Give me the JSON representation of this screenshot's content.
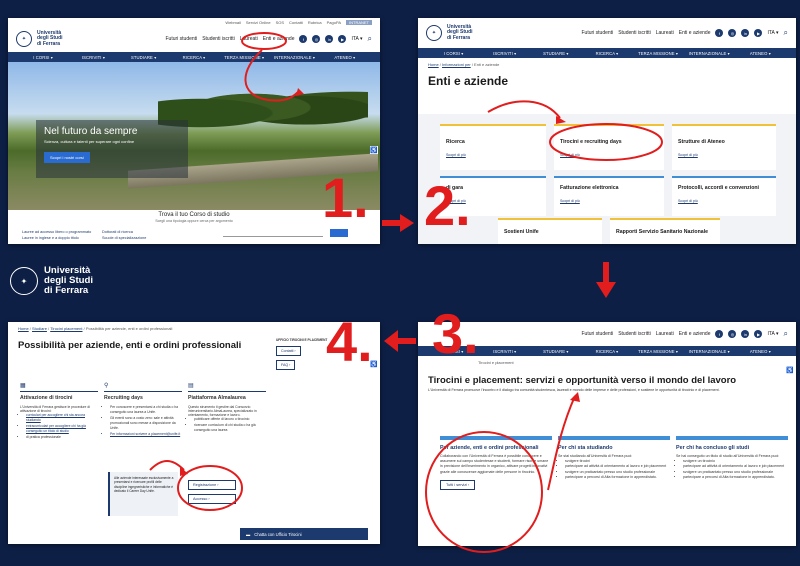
{
  "colors": {
    "brand": "#1d3a6e",
    "annotation": "#e11d1d",
    "accent_blue": "#3f8ed6",
    "accent_yellow": "#f0c23a",
    "background": "#0d1f44"
  },
  "steps": [
    "1.",
    "2.",
    "3.",
    "4."
  ],
  "logo": {
    "line1": "Università",
    "line2": "degli Studi",
    "line3": "di Ferrara"
  },
  "utility_links": [
    "Webmail",
    "Servizi Online",
    "SOS",
    "Contatti",
    "Rubrica",
    "PagoPA",
    "INTRANET"
  ],
  "header": {
    "links": [
      "Futuri studenti",
      "Studenti iscritti",
      "Laureati",
      "Enti e aziende"
    ],
    "lang": "ITA ▾",
    "social": [
      "f",
      "◎",
      "in",
      "▶"
    ]
  },
  "nav": [
    "I CORSI ▾",
    "ISCRIVITI ▾",
    "STUDIARE ▾",
    "RICERCA ▾",
    "TERZA MISSIONE ▾",
    "INTERNAZIONALE ▾",
    "ATENEO ▾"
  ],
  "panel1": {
    "hero_title": "Nel futuro da sempre",
    "hero_subtitle": "Scienza, cultura e talenti per superare ogni confine",
    "hero_button": "Scopri i nostri corsi",
    "corsi_title": "Trova il tuo Corso di studio",
    "corsi_subtitle": "Scegli una tipologia oppure cerca per argomento",
    "corsi_links": [
      "Lauree ad accesso libero o programmato",
      "Dottorati di ricerca",
      "Lauree in inglese e a doppio titolo",
      "Scuole di specializzazione"
    ]
  },
  "panel2": {
    "breadcrumb": [
      "Home",
      "Informazioni per",
      "Enti e aziende"
    ],
    "title": "Enti e aziende",
    "more": "Scopri di più",
    "cards": [
      "Ricerca",
      "Tirocini e recruiting days",
      "Strutture di Ateneo",
      "di gara",
      "Fatturazione elettronica",
      "Protocolli, accordi e convenzioni",
      "Sostieni Unife",
      "Rapporti Servizio Sanitario Nazionale"
    ]
  },
  "panel3": {
    "breadcrumb": "Tirocini e placement",
    "title": "Tirocini e placement: servizi e opportunità verso il mondo del lavoro",
    "intro": "L'Università di Ferrara promuove l'incontro e il dialogo tra comunità studentesca, laureati e mondo delle imprese e delle professioni, e sostiene le opportunità di tirocinio e di placement.",
    "columns": [
      {
        "title": "Per aziende, enti e ordini professionali",
        "text": "Collaborando con l'Università di Ferrara è possibile conoscere e assumere sul campo studentesse e studenti, formare risorse umane in previsione dell'inserimento in organico, attivare progetti innovativi grazie alle conoscenze aggiornate delle persone in tirocinio.",
        "button": "Tutti i servizi  ›"
      },
      {
        "title": "Per chi sta studiando",
        "text": "Se stai studiando all'Università di Ferrara puoi:",
        "items": [
          "svolgere tirocini",
          "partecipare ad attività di orientamento al lavoro e job placement",
          "svolgere un praticantato presso uno studio professionale",
          "partecipare a percorsi di Alta formazione in apprendistato."
        ]
      },
      {
        "title": "Per chi ha concluso gli studi",
        "text": "Se hai conseguito un titolo di studio all'Università di Ferrara puoi:",
        "items": [
          "svolgere un tirocinio",
          "partecipare ad attività di orientamento al lavoro e job placement",
          "svolgere un praticantato presso uno studio professionale",
          "partecipare a percorsi di Alta formazione in apprendistato."
        ]
      }
    ]
  },
  "panel4": {
    "breadcrumb": [
      "Home",
      "Studiare",
      "Tirocini placement",
      "Possibilità per aziende, enti e ordini professionali"
    ],
    "title": "Possibilità per aziende, enti e ordini professionali",
    "side_title": "UFFICIO TIROCINI E PLACEMENT",
    "side_buttons": [
      "Contatti  ›",
      "FAQ  ›"
    ],
    "columns": [
      {
        "icon": "▦",
        "title": "Attivazione di tirocini",
        "text": "L'Università di Ferrara gestisce le procedure di attivazione di tirocini:",
        "items": [
          "curriculari per accogliere chi sta ancora studiando",
          "extracurriculari per accogliere chi ha già conseguito un titolo di studio",
          "di pratica professionale"
        ]
      },
      {
        "icon": "⚲",
        "title": "Recruiting days",
        "items": [
          "Per conoscere e presentarsi a chi studia o ha conseguito una laurea a Unife.",
          "Gli eventi sono a costo zero: sale e attività promozionali sono messe a disposizione da Unife.",
          "Per informazioni scrivere a placement@unife.it"
        ]
      },
      {
        "icon": "▤",
        "title": "Piattaforma Almalaurea",
        "text": "Questo strumento ti gestire dal Consorzio interuniversitario AlmaLaurea, specializzato in orientamento, formazione e lavoro.",
        "items": [
          "pubblicare offerte di lavoro o tirocinio",
          "ricercare curriculum di chi studia o ha già conseguito una laurea"
        ]
      }
    ],
    "note": "Alle aziende interessate esclusivamente a presentarsi e ricercare profili delle discipline ingegneristiche e informatiche è dedicato il Career Day Unife.",
    "buttons": [
      "Registrazione  ›",
      "Accesso  ›"
    ],
    "chat": "Chatta con Ufficio Tirocini"
  }
}
